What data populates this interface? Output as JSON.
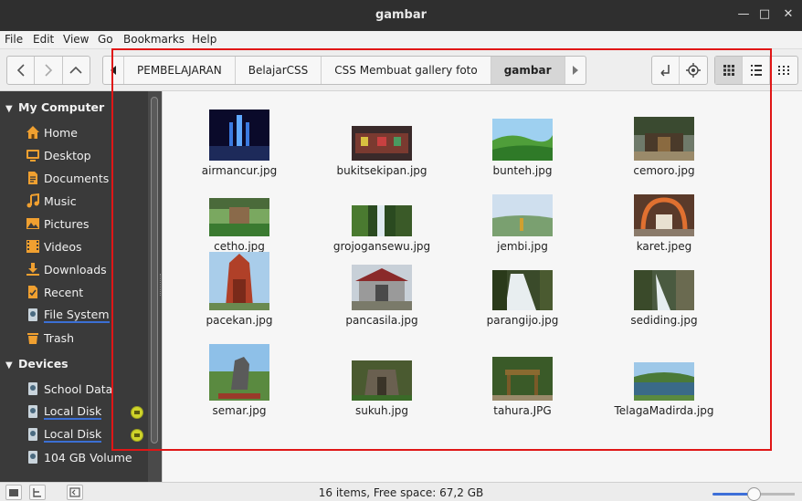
{
  "window": {
    "title": "gambar"
  },
  "menu": [
    "File",
    "Edit",
    "View",
    "Go",
    "Bookmarks",
    "Help"
  ],
  "breadcrumbs": [
    "PEMBELAJARAN",
    "BelajarCSS",
    "CSS Membuat gallery foto",
    "gambar"
  ],
  "sidebar": {
    "computer_header": "My Computer",
    "computer_items": [
      {
        "label": "Home",
        "icon": "home-icon"
      },
      {
        "label": "Desktop",
        "icon": "desktop-icon"
      },
      {
        "label": "Documents",
        "icon": "documents-icon"
      },
      {
        "label": "Music",
        "icon": "music-icon"
      },
      {
        "label": "Pictures",
        "icon": "pictures-icon"
      },
      {
        "label": "Videos",
        "icon": "videos-icon"
      },
      {
        "label": "Downloads",
        "icon": "downloads-icon"
      },
      {
        "label": "Recent",
        "icon": "recent-icon"
      },
      {
        "label": "File System",
        "icon": "drive-icon"
      },
      {
        "label": "Trash",
        "icon": "trash-icon"
      }
    ],
    "devices_header": "Devices",
    "device_items": [
      {
        "label": "School Data",
        "icon": "drive-icon"
      },
      {
        "label": "Local Disk",
        "icon": "drive-icon"
      },
      {
        "label": "Local Disk",
        "icon": "drive-icon"
      },
      {
        "label": "104 GB Volume",
        "icon": "drive-icon"
      }
    ]
  },
  "files": [
    {
      "name": "airmancur.jpg"
    },
    {
      "name": "bukitsekipan.jpg"
    },
    {
      "name": "bunteh.jpg"
    },
    {
      "name": "cemoro.jpg"
    },
    {
      "name": "cetho.jpg"
    },
    {
      "name": "grojogansewu.jpg"
    },
    {
      "name": "jembi.jpg"
    },
    {
      "name": "karet.jpeg"
    },
    {
      "name": "pacekan.jpg"
    },
    {
      "name": "pancasila.jpg"
    },
    {
      "name": "parangijo.jpg"
    },
    {
      "name": "sediding.jpg"
    },
    {
      "name": "semar.jpg"
    },
    {
      "name": "sukuh.jpg"
    },
    {
      "name": "tahura.JPG"
    },
    {
      "name": "TelagaMadirda.jpg"
    }
  ],
  "status": {
    "text": "16 items, Free space: 67,2 GB",
    "zoom_level": 0.45
  },
  "colors": {
    "accent": "#3d6fd8",
    "highlight_box": "#e01616",
    "sidebar_bg": "#3a3a3a"
  }
}
